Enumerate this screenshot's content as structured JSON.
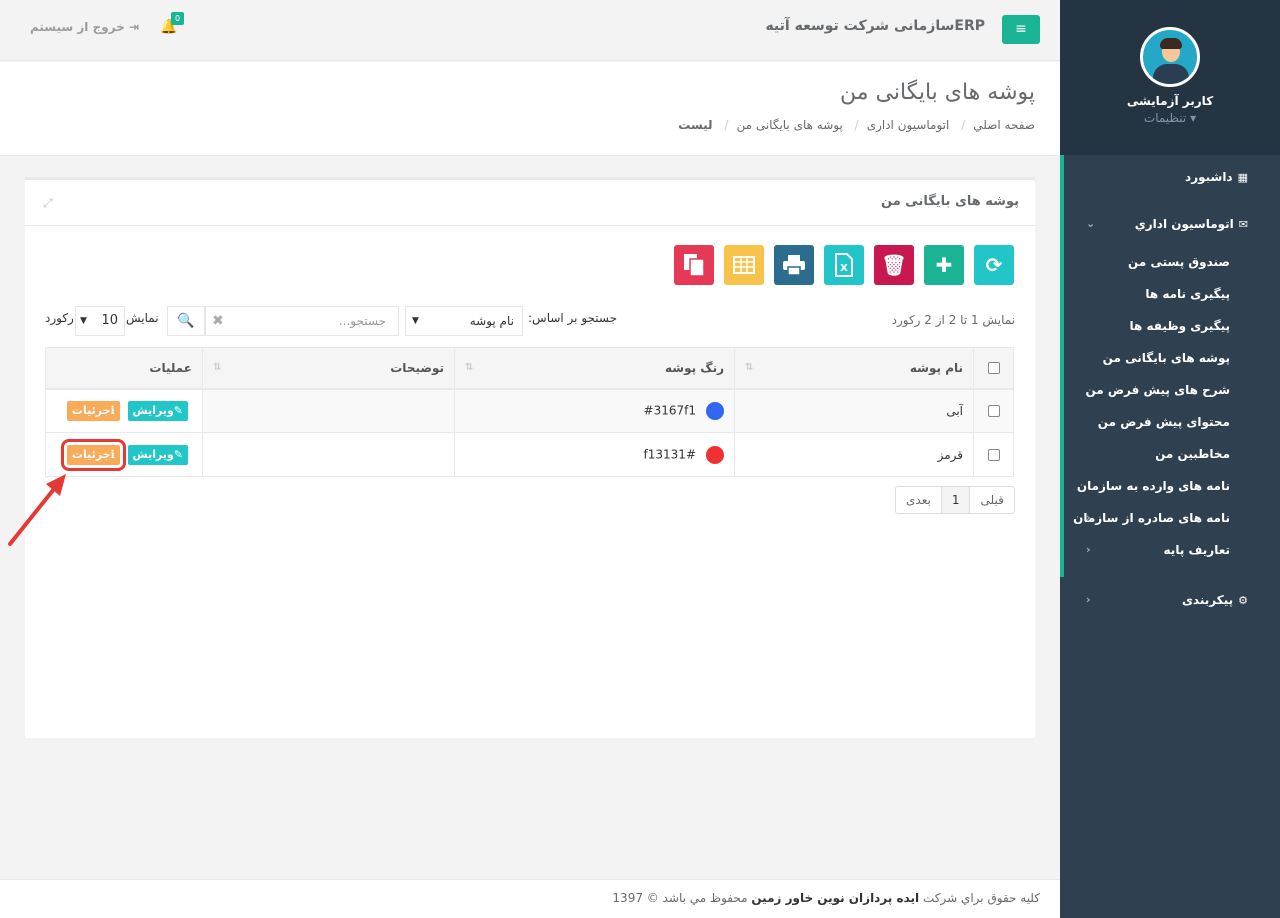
{
  "topbar": {
    "brand": "ERPسازمانی شرکت توسعه آتیه",
    "notification_count": "0",
    "logout_label": "خروج از سیستم"
  },
  "sidebar": {
    "user_name": "کاربر آزمایشی",
    "settings_label": "تنظیمات",
    "dashboard": "داشبورد",
    "office_automation": "اتوماسیون اداري",
    "sub_items": [
      "صندوق پستی من",
      "پیگیری نامه ها",
      "پیگیری وظیفه ها",
      "پوشه های بایگانی من",
      "شرح های پیش فرض من",
      "محتوای پیش فرض من",
      "مخاطبین من",
      "نامه های وارده به سازمان",
      "نامه های صادره از سازمان",
      "تعاریف پایه"
    ],
    "configuration": "پیکربندی"
  },
  "heading": {
    "title": "پوشه های بایگانی من",
    "breadcrumb": [
      "صفحه اصلي",
      "اتوماسیون اداری",
      "پوشه های بایگانی من",
      "لیست"
    ]
  },
  "panel": {
    "title": "پوشه های بایگانی من",
    "info": "نمایش 1 تا 2 از 2 رکورد",
    "search_by_label": "جستجو بر اساس:",
    "search_field": "نام پوشه",
    "search_placeholder": "جستجو...",
    "show_label": "نمایش",
    "page_length": "10",
    "records_label": "رکورد",
    "columns": [
      "نام پوشه",
      "رنگ پوشه",
      "توضیحات",
      "عملیات"
    ],
    "rows": [
      {
        "name": "آبی",
        "color_hex": "#3167f1",
        "color_text": "#3167f1",
        "description": ""
      },
      {
        "name": "قرمز",
        "color_hex": "#f13131",
        "color_text": "f13131#",
        "description": ""
      }
    ],
    "edit_label": "ویرایش",
    "details_label": "جزئیات",
    "pager": {
      "prev": "قبلی",
      "page": "1",
      "next": "بعدی"
    }
  },
  "footer": {
    "prefix": "کلیه حقوق براي شرکت",
    "company": "ایده پردازان نوین خاور زمین",
    "suffix": "محفوظ مي باشد © 1397"
  }
}
